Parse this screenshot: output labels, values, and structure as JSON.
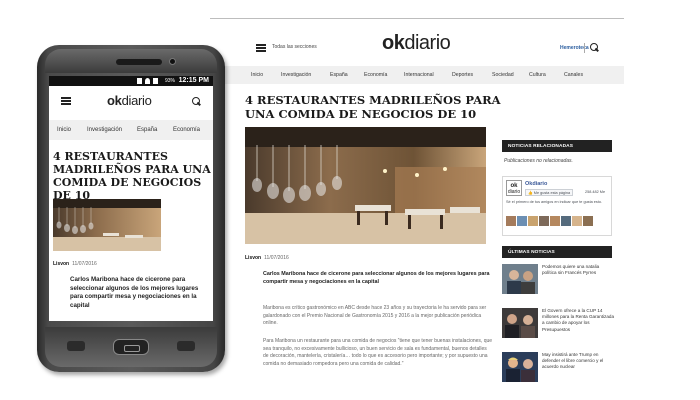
{
  "desktop": {
    "header": {
      "sections_label": "Todas las secciones",
      "logo_ok": "ok",
      "logo_rest": "diario",
      "hemeroteca": "Hemeroteca"
    },
    "nav": [
      "Inicio",
      "Investigación",
      "España",
      "Economía",
      "Internacional",
      "Deportes",
      "Sociedad",
      "Cultura",
      "Canales"
    ],
    "article": {
      "title": "4 RESTAURANTES MADRILEÑOS PARA UNA COMIDA DE NEGOCIOS DE 10",
      "author": "Lisvon",
      "date": "11/07/2016",
      "lead": "Carlos Maribona hace de cicerone para seleccionar algunos de los mejores lugares para compartir mesa y negociaciones en la capital",
      "para1": "Maribona es crítico gastronómico en ABC desde hace 23 años y su trayectoria le ha servido para ser galardonado con el Premio Nacional de Gastronomía 2015 y 2016 a la mejor publicación periódica online.",
      "para2": "Para Maribona un restaurante para una comida de negocios “tiene que tener buenas instalaciones, que sea tranquilo, no excesivamente bullicioso, un buen servicio de sala es fundamental, buenos detalles de decoración, mantelería, cristalería… todo lo que es accesorio pero importante; y por supuesto una comida no demasiado rompedora pero una comida de calidad.”"
    },
    "sidebar": {
      "related_header": "NOTICIAS RELACIONADAS",
      "no_related": "Publicaciones no relacionadas.",
      "fb_page_name": "Okdiario",
      "fb_like": "Me gusta esta página",
      "fb_count": "258.482 Me",
      "fb_friends": "Sé el primero de tus amigos en indicar que te gusta esto.",
      "latest_header": "ÚLTIMAS NOTICIAS",
      "news": [
        "Podemos quiere una natalia política sin Francés Pyrres",
        "El Govern ofrece a la CUP 14 millones para la Renta Garantizada a cambio de apoyar los Presupuestos",
        "May insistirá ante Trump en defender el libre comercio y el acuerdo nuclear"
      ]
    }
  },
  "phone": {
    "status_battery": "93%",
    "status_time": "12:15 PM",
    "logo_ok": "ok",
    "logo_rest": "diario",
    "nav": [
      "Inicio",
      "Investigación",
      "España",
      "Economía"
    ],
    "title": "4 RESTAURANTES MADRILEÑOS PARA UNA COMIDA DE NEGOCIOS DE 10",
    "author": "Lisvon",
    "date": "11/07/2016",
    "lead": "Carlos Maribona hace de cicerone para seleccionar algunos de los mejores lugares para compartir mesa y negociaciones en la capital"
  }
}
